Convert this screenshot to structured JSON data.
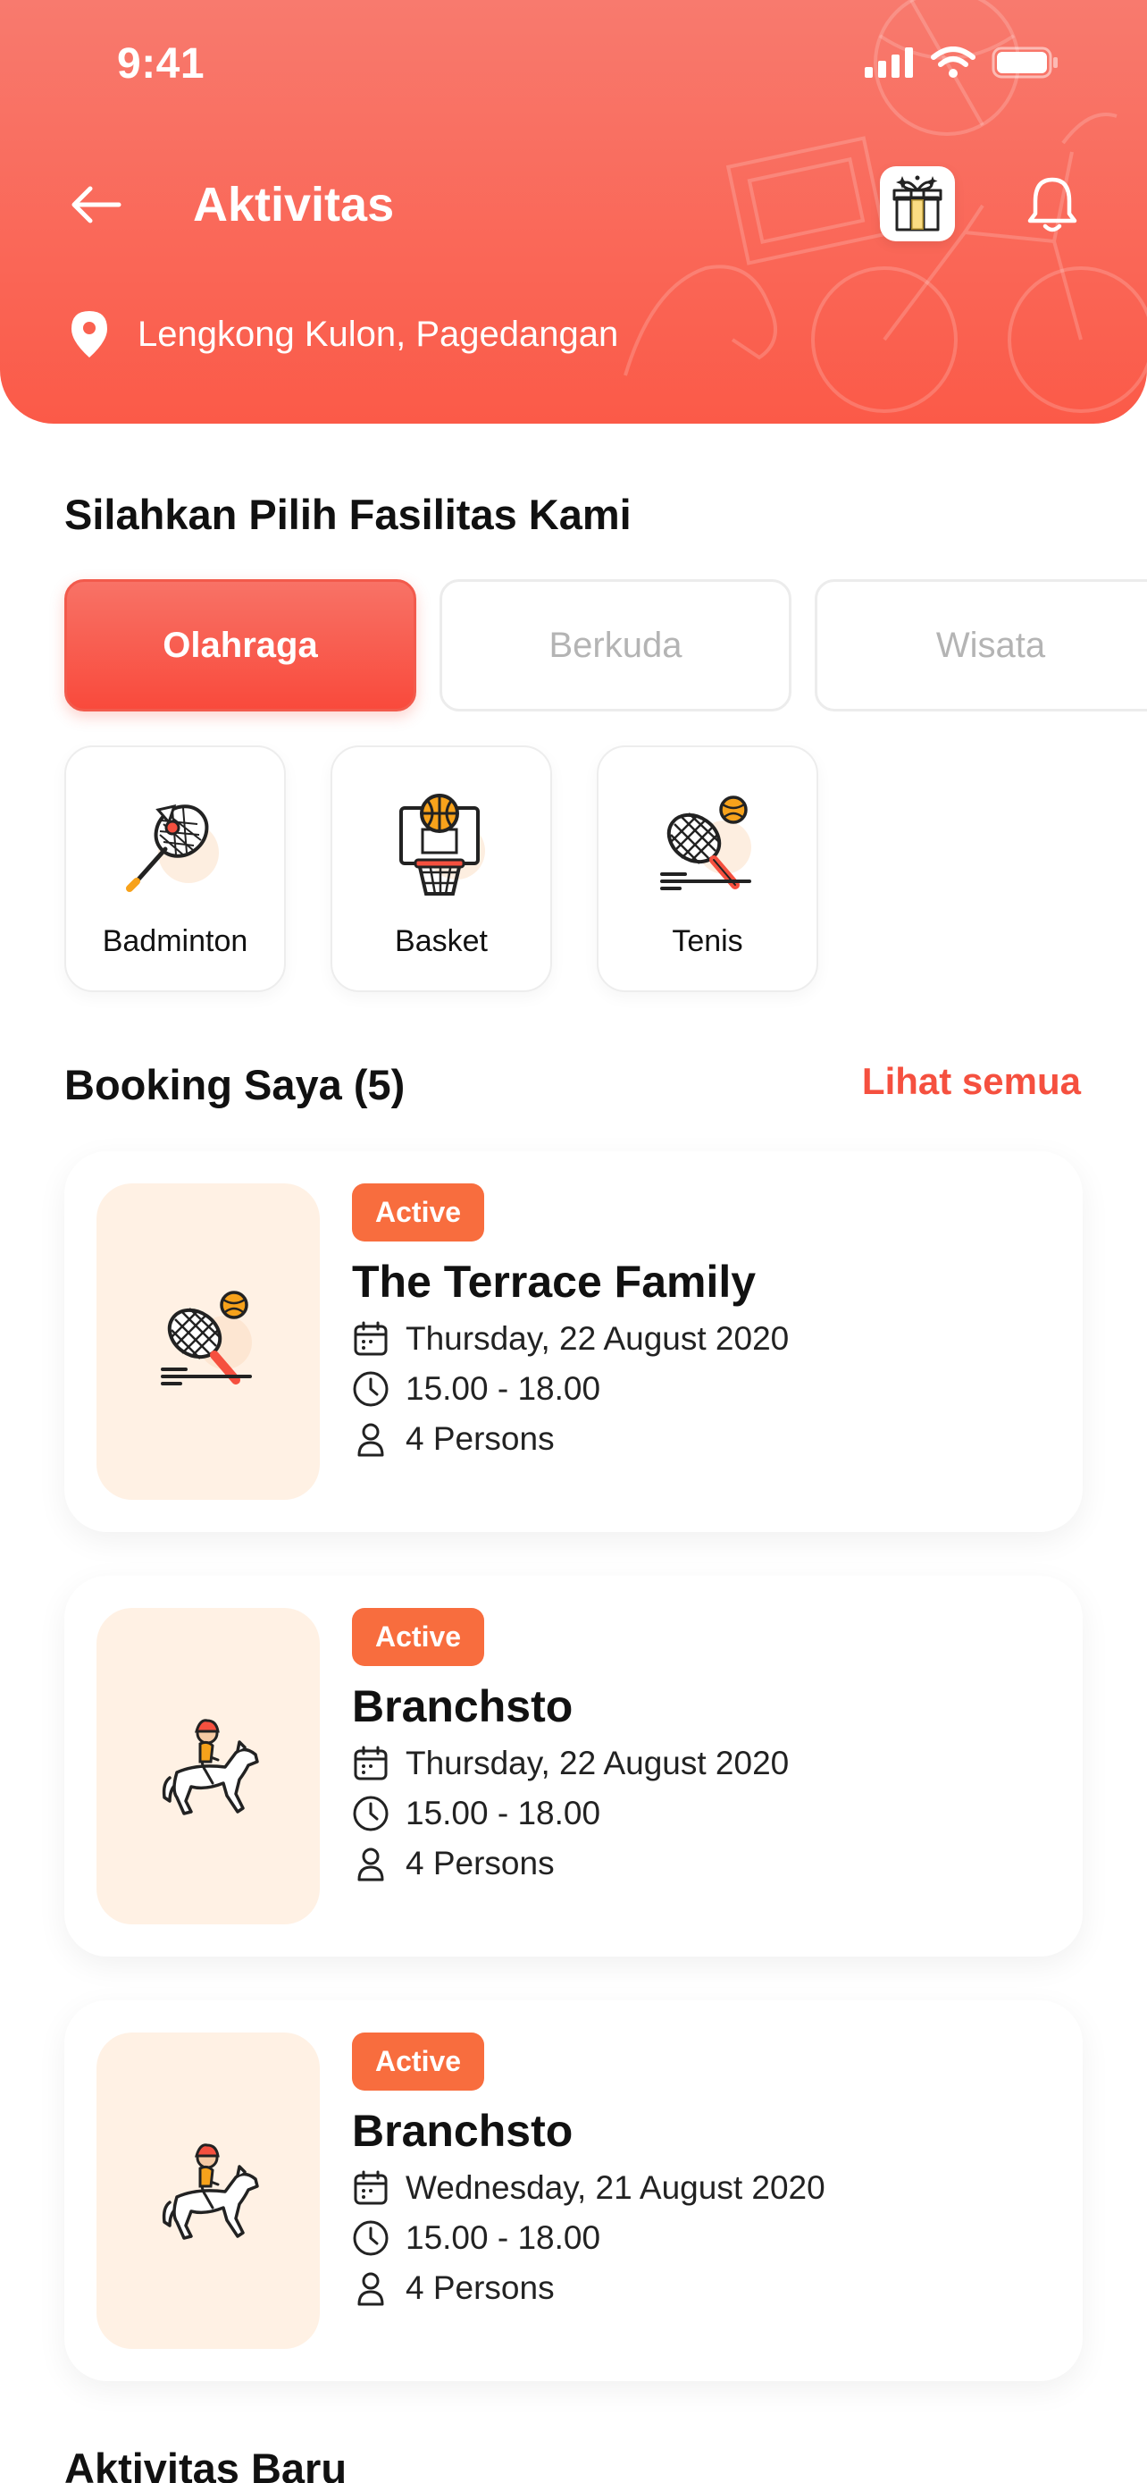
{
  "status_bar": {
    "time": "9:41"
  },
  "header": {
    "title": "Aktivitas",
    "location": "Lengkong Kulon, Pagedangan"
  },
  "facility_section": {
    "title": "Silahkan Pilih Fasilitas Kami"
  },
  "tabs": [
    {
      "label": "Olahraga",
      "active": true
    },
    {
      "label": "Berkuda",
      "active": false
    },
    {
      "label": "Wisata",
      "active": false
    }
  ],
  "facilities": [
    {
      "label": "Badminton",
      "icon": "badminton-icon"
    },
    {
      "label": "Basket",
      "icon": "basketball-icon"
    },
    {
      "label": "Tenis",
      "icon": "tennis-icon"
    }
  ],
  "bookings_section": {
    "title": "Booking Saya (5)",
    "see_all": "Lihat semua"
  },
  "bookings": [
    {
      "status": "Active",
      "name": "The Terrace Family",
      "date": "Thursday, 22 August 2020",
      "time": "15.00 - 18.00",
      "persons": "4 Persons",
      "icon": "tennis-icon"
    },
    {
      "status": "Active",
      "name": "Branchsto",
      "date": "Thursday, 22 August 2020",
      "time": "15.00 - 18.00",
      "persons": "4 Persons",
      "icon": "horse-riding-icon"
    },
    {
      "status": "Active",
      "name": "Branchsto",
      "date": "Wednesday, 21 August 2020",
      "time": "15.00 - 18.00",
      "persons": "4 Persons",
      "icon": "horse-riding-icon"
    }
  ],
  "new_activities_section": {
    "title": "Aktivitas Baru"
  },
  "colors": {
    "header_gradient": [
      "#f87a6e",
      "#fb5a48"
    ],
    "accent": "#f5503f",
    "badge": "#f86d3e",
    "thumb_bg": "#fff1e4"
  }
}
